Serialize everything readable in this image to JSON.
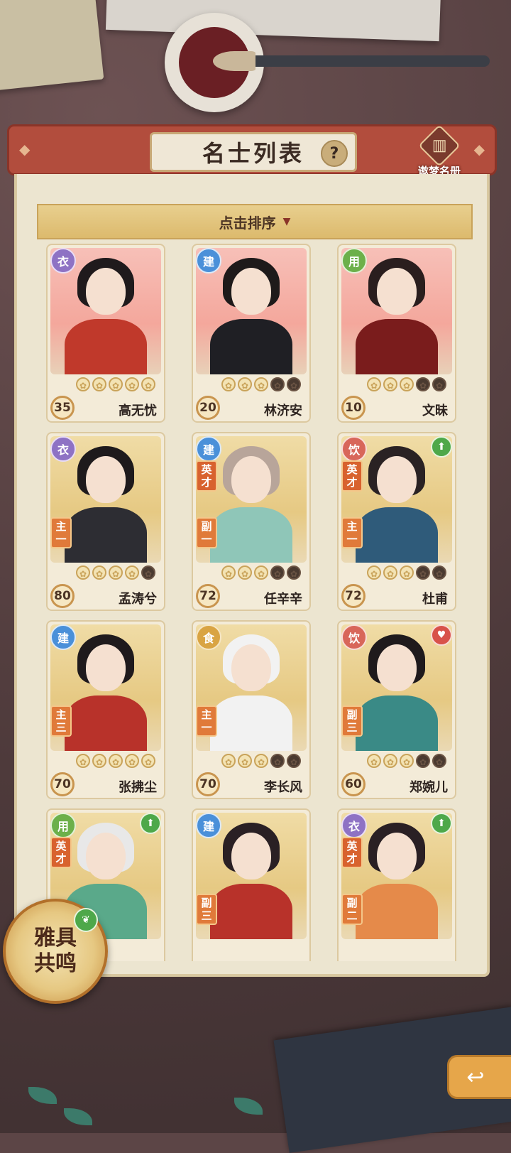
{
  "header": {
    "title": "名士列表",
    "help_icon": "question-icon",
    "dream_book_label": "遨梦名册",
    "dream_book_icon": "book-icon"
  },
  "sort": {
    "label": "点击排序",
    "arrow_icon": "triangle-down-icon"
  },
  "cards": [
    {
      "name": "高无忧",
      "level": "35",
      "type": "衣",
      "type_color": "purple",
      "bg": "pink",
      "stars": 5,
      "filled": 5,
      "talent": "",
      "role": "",
      "role_num": "",
      "arrow": ""
    },
    {
      "name": "林济安",
      "level": "20",
      "type": "建",
      "type_color": "blue",
      "bg": "pink",
      "stars": 5,
      "filled": 3,
      "talent": "",
      "role": "",
      "role_num": "",
      "arrow": ""
    },
    {
      "name": "文昧",
      "level": "10",
      "type": "用",
      "type_color": "green",
      "bg": "pink",
      "stars": 5,
      "filled": 3,
      "talent": "",
      "role": "",
      "role_num": "",
      "arrow": ""
    },
    {
      "name": "孟涛兮",
      "level": "80",
      "type": "衣",
      "type_color": "purple",
      "bg": "gold",
      "stars": 5,
      "filled": 4,
      "talent": "",
      "role": "主",
      "role_num": "一",
      "arrow": ""
    },
    {
      "name": "任辛辛",
      "level": "72",
      "type": "建",
      "type_color": "blue",
      "bg": "gold",
      "stars": 5,
      "filled": 3,
      "talent": "英才",
      "role": "副",
      "role_num": "一",
      "arrow": ""
    },
    {
      "name": "杜甫",
      "level": "72",
      "type": "饮",
      "type_color": "red",
      "bg": "gold",
      "stars": 5,
      "filled": 3,
      "talent": "英才",
      "role": "主",
      "role_num": "一",
      "arrow": "up"
    },
    {
      "name": "张拂尘",
      "level": "70",
      "type": "建",
      "type_color": "blue",
      "bg": "gold",
      "stars": 5,
      "filled": 5,
      "talent": "",
      "role": "主",
      "role_num": "三",
      "arrow": ""
    },
    {
      "name": "李长风",
      "level": "70",
      "type": "食",
      "type_color": "gold",
      "bg": "gold",
      "stars": 5,
      "filled": 3,
      "talent": "",
      "role": "主",
      "role_num": "一",
      "arrow": ""
    },
    {
      "name": "郑婉儿",
      "level": "60",
      "type": "饮",
      "type_color": "red",
      "bg": "gold",
      "stars": 5,
      "filled": 3,
      "talent": "",
      "role": "副",
      "role_num": "三",
      "arrow": "heart"
    },
    {
      "name": "",
      "level": "",
      "type": "用",
      "type_color": "green",
      "bg": "gold",
      "stars": 0,
      "filled": 0,
      "talent": "英才",
      "role": "",
      "role_num": "",
      "arrow": "up"
    },
    {
      "name": "",
      "level": "",
      "type": "建",
      "type_color": "blue",
      "bg": "gold",
      "stars": 0,
      "filled": 0,
      "talent": "",
      "role": "副",
      "role_num": "三",
      "arrow": ""
    },
    {
      "name": "",
      "level": "",
      "type": "衣",
      "type_color": "purple",
      "bg": "gold",
      "stars": 0,
      "filled": 0,
      "talent": "英才",
      "role": "副",
      "role_num": "二",
      "arrow": "up"
    }
  ],
  "resonance": {
    "label": "雅具共鸣"
  },
  "back_button": {
    "icon": "back-arrow-icon"
  }
}
